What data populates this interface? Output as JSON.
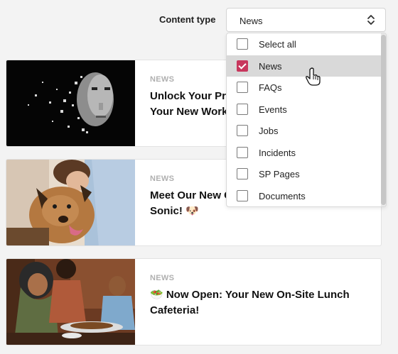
{
  "filter": {
    "label": "Content type",
    "selected_value": "News"
  },
  "dropdown": {
    "options": [
      {
        "label": "Select all",
        "checked": false
      },
      {
        "label": "News",
        "checked": true
      },
      {
        "label": "FAQs",
        "checked": false
      },
      {
        "label": "Events",
        "checked": false
      },
      {
        "label": "Jobs",
        "checked": false
      },
      {
        "label": "Incidents",
        "checked": false
      },
      {
        "label": "SP Pages",
        "checked": false
      },
      {
        "label": "Documents",
        "checked": false
      }
    ]
  },
  "cards": [
    {
      "category": "NEWS",
      "title": "Unlock Your Pro... Your New Work..."
    },
    {
      "category": "NEWS",
      "title": "Meet Our New C... Sonic! 🐶"
    },
    {
      "category": "NEWS",
      "title": "🥗 Now Open: Your New On-Site Lunch Cafeteria!"
    }
  ],
  "card_lines": [
    [
      "Unlock Your Pro",
      "Your New Work"
    ],
    [
      "Meet Our New C",
      "Sonic! 🐶"
    ],
    [
      "🥗 Now Open: Your New On-Site Lunch",
      "Cafeteria!"
    ]
  ],
  "colors": {
    "accent": "#c8375d",
    "page_bg": "#f3f3f3"
  },
  "icons": {
    "select_chevron": "chevron-up-down-icon",
    "cursor": "hand-pointer-icon"
  }
}
